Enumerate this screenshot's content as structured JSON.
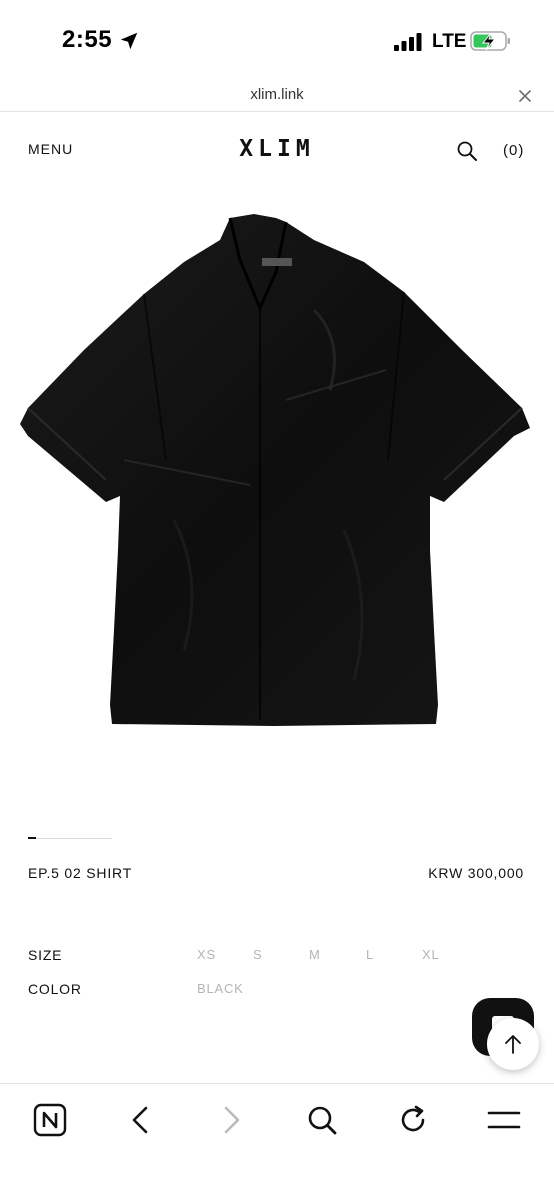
{
  "status_bar": {
    "time": "2:55",
    "network": "LTE",
    "icons": [
      "location-arrow-icon",
      "signal-bars-icon",
      "battery-charging-icon"
    ]
  },
  "browser": {
    "url": "xlim.link",
    "close_icon": "close-icon"
  },
  "header": {
    "menu_label": "MENU",
    "brand": "XLIM",
    "search_icon": "search-icon",
    "cart_label": "(0)"
  },
  "product": {
    "name": "EP.5 02 SHIRT",
    "price": "KRW 300,000",
    "image": "black-short-sleeve-shirt",
    "size_label": "SIZE",
    "sizes": [
      "XS",
      "S",
      "M",
      "L",
      "XL"
    ],
    "color_label": "COLOR",
    "colors": [
      "BLACK"
    ]
  },
  "floating": {
    "chat_icon": "chat-icon",
    "top_icon": "arrow-up-icon"
  },
  "toolbar": {
    "icons": [
      "naver-home-icon",
      "back-icon",
      "forward-icon",
      "search-icon",
      "reload-icon",
      "menu-icon"
    ]
  },
  "colors": {
    "text": "#111111",
    "muted": "#b5b5b5",
    "background": "#ffffff"
  }
}
